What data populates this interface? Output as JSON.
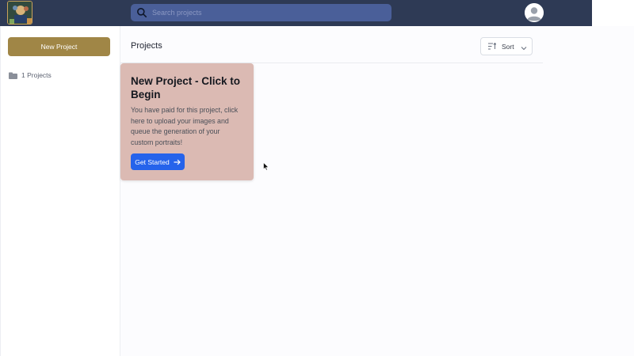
{
  "search": {
    "placeholder": "Search projects"
  },
  "sidebar": {
    "new_project_label": "New Project",
    "projects_count": "1 Projects"
  },
  "main": {
    "title": "Projects",
    "sort_label": "Sort"
  },
  "card": {
    "title": "New Project - Click to Begin",
    "text": "You have paid for this project, click here to upload your images and queue the generation of your custom portraits!",
    "button_label": "Get Started"
  },
  "colors": {
    "topbar": "#2e3a55",
    "search_bg": "#4a5f99",
    "new_project_button": "#a08646",
    "card_bg": "#dbbab3",
    "primary_button": "#2563eb"
  },
  "icons": [
    "logo",
    "search-icon",
    "avatar-icon",
    "folder-icon",
    "sort-icon",
    "chevron-down-icon",
    "arrow-right-icon",
    "mouse-cursor-icon"
  ]
}
